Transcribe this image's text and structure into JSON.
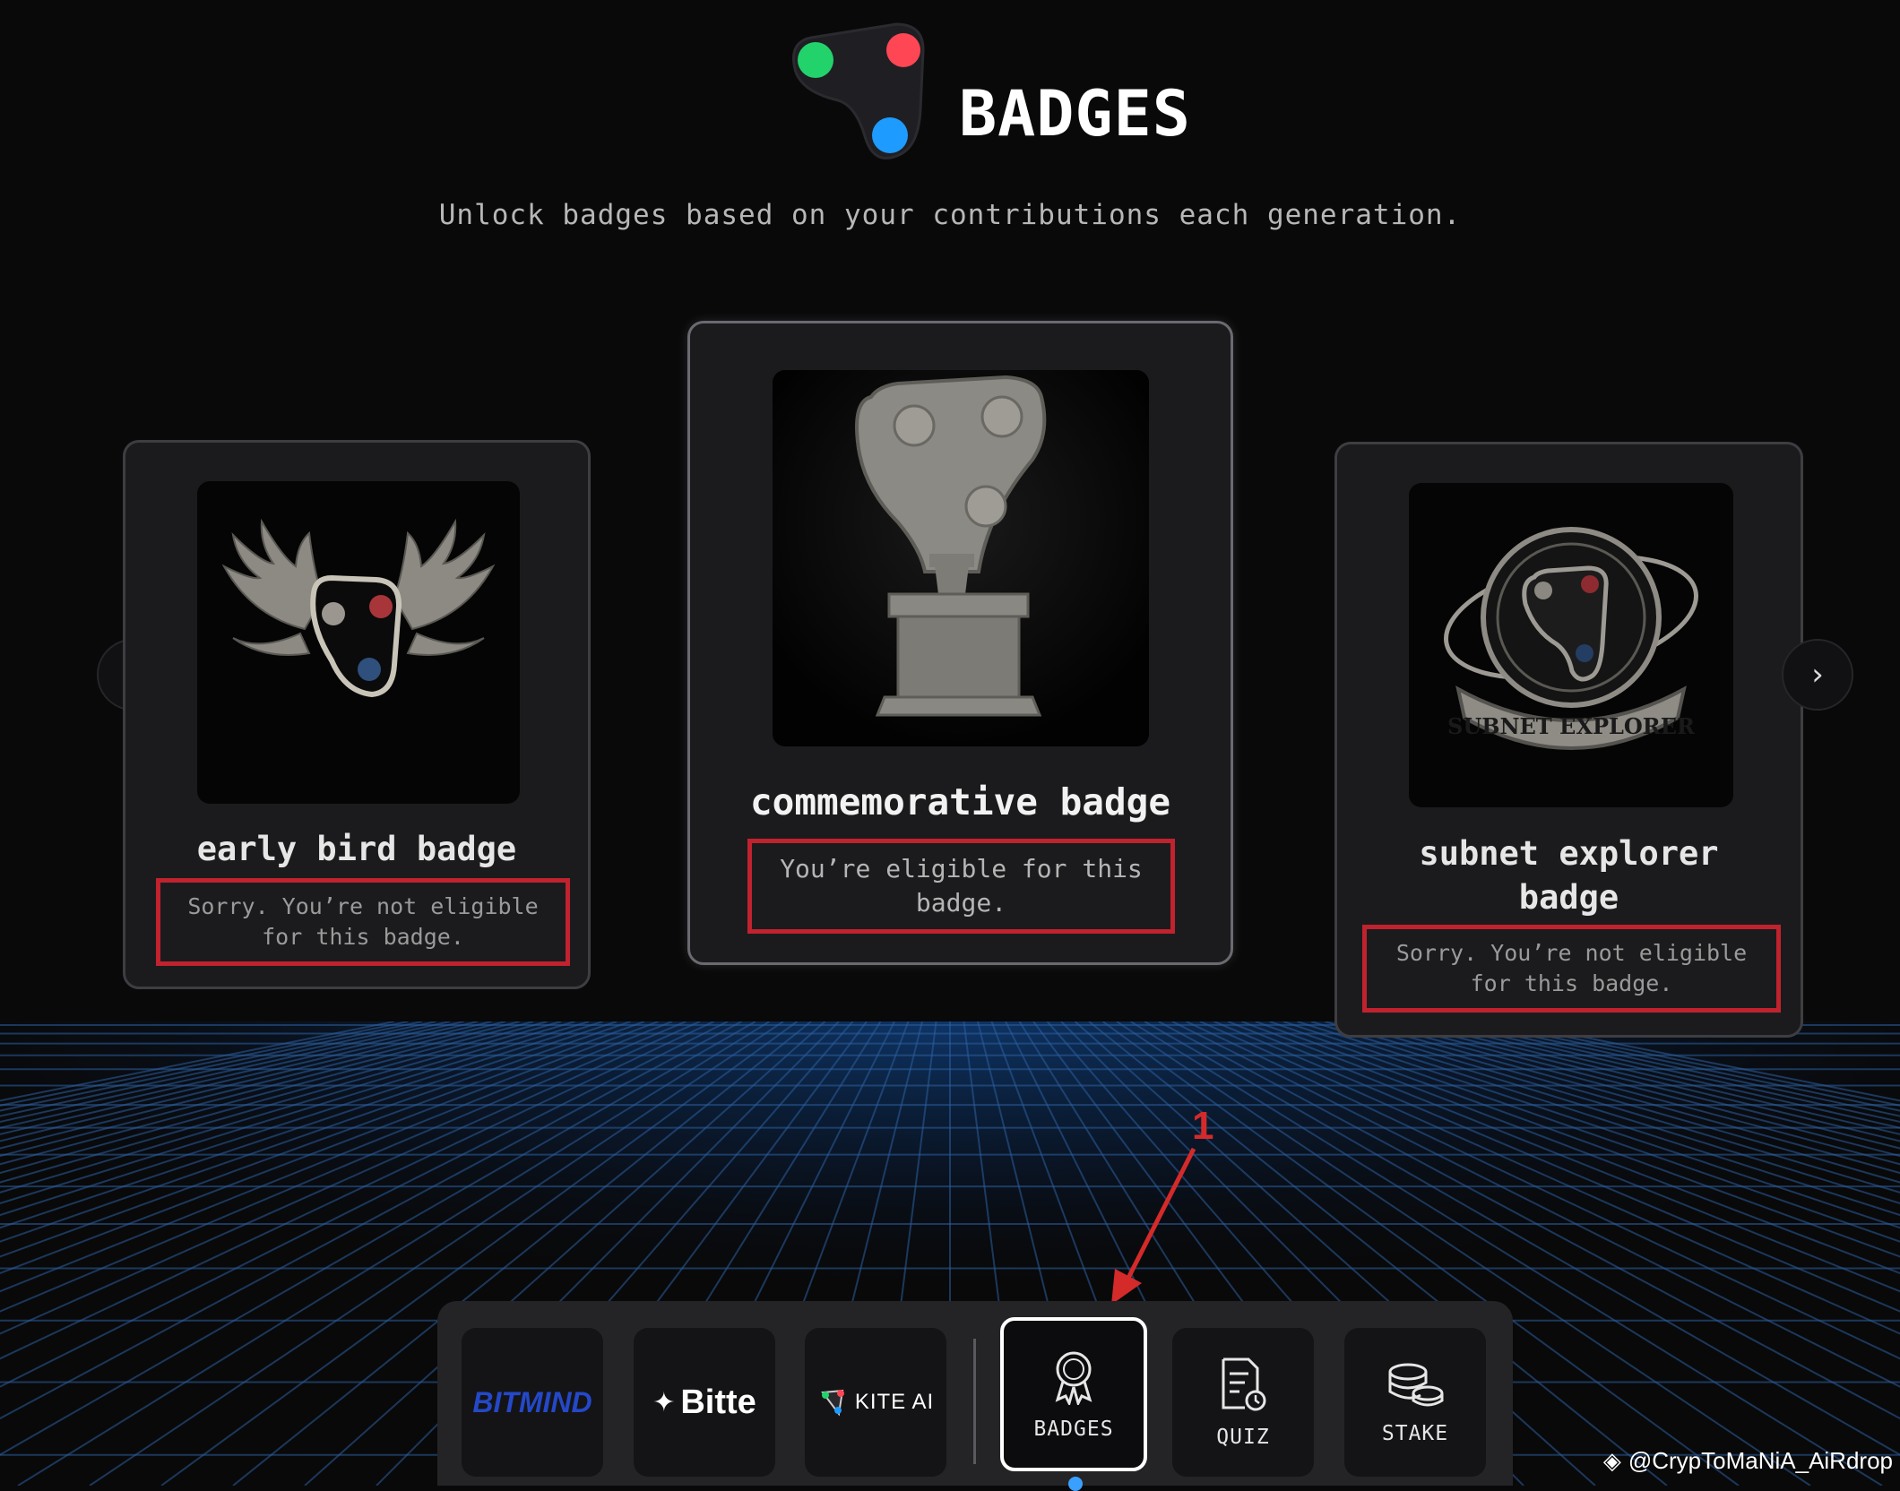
{
  "header": {
    "title": "BADGES",
    "subtitle": "Unlock badges based on your contributions each generation."
  },
  "carousel": {
    "prev_glyph": "‹",
    "next_glyph": "›",
    "cards": [
      {
        "title": "early bird badge",
        "message": "Sorry. You’re not eligible for this badge.",
        "eligible": false,
        "image_icon": "winged-badge-icon"
      },
      {
        "title": "commemorative badge",
        "message": "You’re eligible for this badge.",
        "eligible": true,
        "image_icon": "stone-statue-icon"
      },
      {
        "title": "subnet explorer badge",
        "message": "Sorry. You’re not eligible for this badge.",
        "eligible": false,
        "image_icon": "subnet-explorer-emblem-icon",
        "emblem_text": "SUBNET EXPLORER"
      }
    ]
  },
  "annotation": {
    "label": "1"
  },
  "dock": {
    "items": [
      {
        "label": "BITMIND",
        "kind": "brand"
      },
      {
        "label": "Bitte",
        "kind": "brand"
      },
      {
        "label": "KITE AI",
        "kind": "brand"
      },
      {
        "label": "BADGES",
        "kind": "nav",
        "active": true,
        "icon": "ribbon-badge-icon"
      },
      {
        "label": "QUIZ",
        "kind": "nav",
        "icon": "quiz-document-icon"
      },
      {
        "label": "STAKE",
        "kind": "nav",
        "icon": "coin-stack-icon"
      }
    ]
  },
  "watermark": {
    "text": "@CrypToMaNiA_AiRdrop"
  },
  "colors": {
    "background": "#09090a",
    "highlight_red": "#c0222e",
    "dot_green": "#22d36b",
    "dot_red": "#ff4655",
    "dot_blue": "#1e9bff",
    "grid_blue": "#1d4f8a"
  }
}
